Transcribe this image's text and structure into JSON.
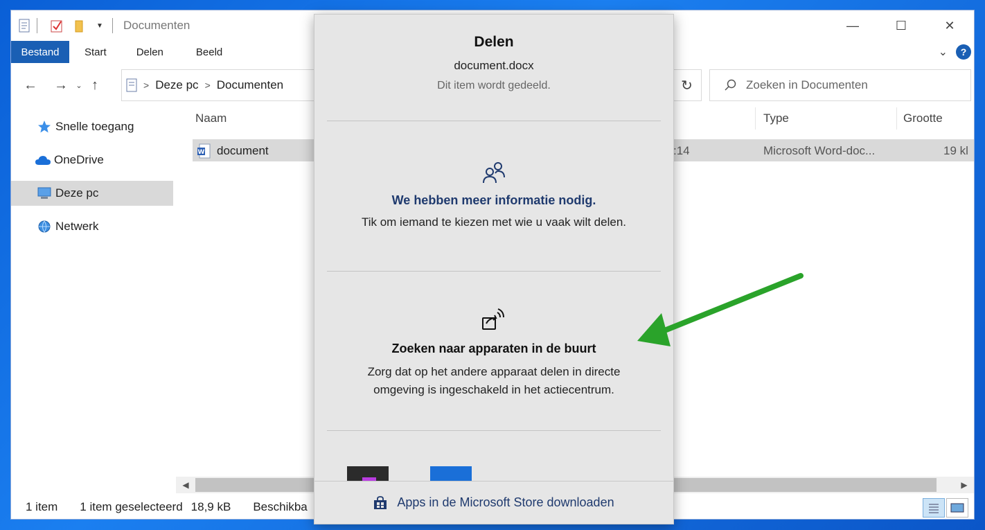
{
  "window": {
    "title": "Documenten"
  },
  "ribbon": {
    "tabs": [
      {
        "label": "Bestand",
        "active": true
      },
      {
        "label": "Start"
      },
      {
        "label": "Delen"
      },
      {
        "label": "Beeld"
      }
    ]
  },
  "address": {
    "crumbs": [
      "Deze pc",
      "Documenten"
    ],
    "search_placeholder": "Zoeken in Documenten"
  },
  "navpane": {
    "items": [
      {
        "label": "Snelle toegang",
        "icon": "star-icon"
      },
      {
        "label": "OneDrive",
        "icon": "cloud-icon"
      },
      {
        "label": "Deze pc",
        "icon": "computer-icon",
        "selected": true
      },
      {
        "label": "Netwerk",
        "icon": "network-icon"
      }
    ]
  },
  "filelist": {
    "columns": {
      "name": "Naam",
      "type": "Type",
      "size": "Grootte"
    },
    "rows": [
      {
        "name": "document",
        "date_fragment": ":14",
        "type": "Microsoft Word-doc...",
        "size": "19 kl"
      }
    ]
  },
  "statusbar": {
    "count": "1 item",
    "selected": "1 item geselecteerd",
    "size": "18,9 kB",
    "availability": "Beschikba"
  },
  "share": {
    "title": "Delen",
    "filename": "document.docx",
    "subtitle": "Dit item wordt gedeeld.",
    "people_title": "We hebben meer informatie nodig.",
    "people_text": "Tik om iemand te kiezen met wie u vaak wilt delen.",
    "nearby_title": "Zoeken naar apparaten in de buurt",
    "nearby_text_1": "Zorg dat op het andere apparaat delen in directe",
    "nearby_text_2": "omgeving is ingeschakeld in het actiecentrum.",
    "store_link": "Apps in de Microsoft Store downloaden"
  },
  "colors": {
    "accent": "#1a5fb4",
    "annotation_arrow": "#2aa32a",
    "desktop": "#1b7ff0"
  }
}
